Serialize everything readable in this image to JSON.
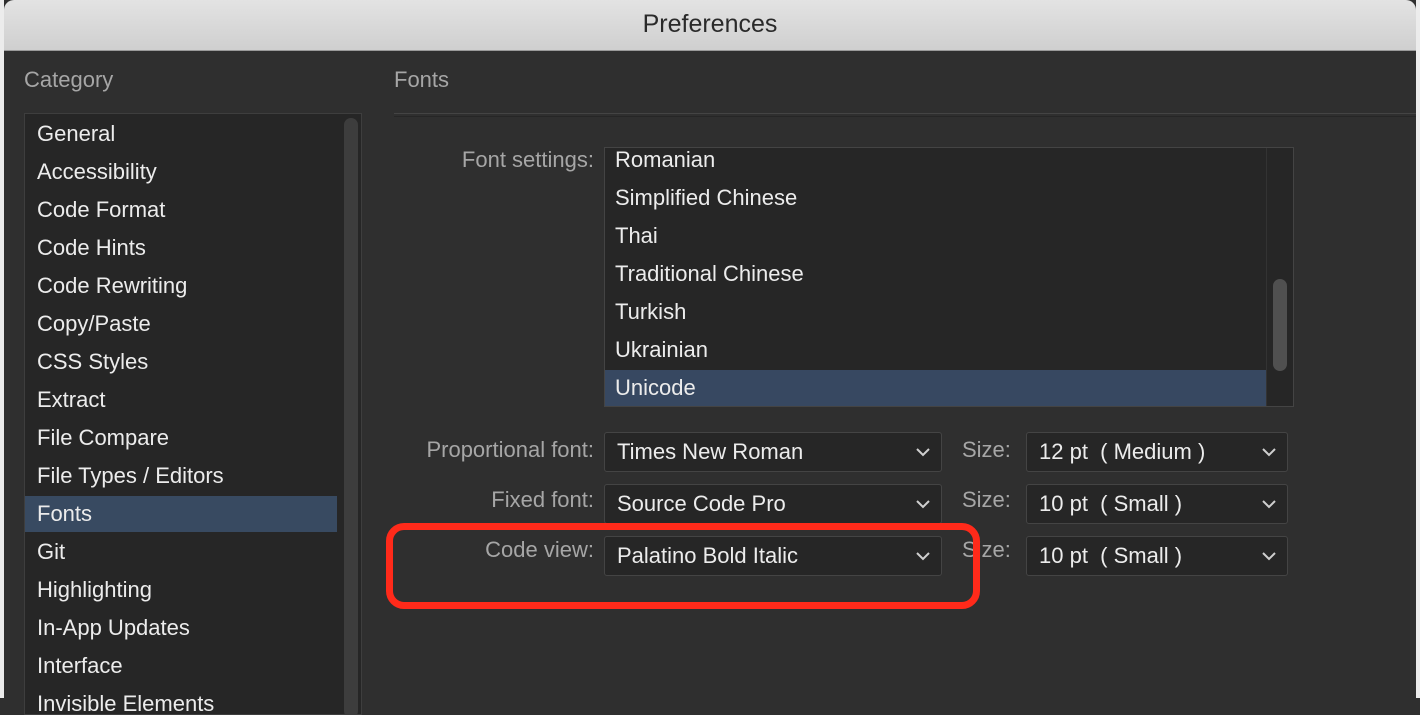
{
  "window": {
    "title": "Preferences"
  },
  "category": {
    "header": "Category",
    "items": [
      "General",
      "Accessibility",
      "Code Format",
      "Code Hints",
      "Code Rewriting",
      "Copy/Paste",
      "CSS Styles",
      "Extract",
      "File Compare",
      "File Types / Editors",
      "Fonts",
      "Git",
      "Highlighting",
      "In-App Updates",
      "Interface",
      "Invisible Elements"
    ],
    "selected": "Fonts"
  },
  "fonts": {
    "header": "Fonts",
    "font_settings_label": "Font settings:",
    "font_settings_items": [
      "Romanian",
      "Simplified Chinese",
      "Thai",
      "Traditional Chinese",
      "Turkish",
      "Ukrainian",
      "Unicode"
    ],
    "font_settings_selected": "Unicode",
    "proportional_label": "Proportional font:",
    "proportional_value": "Times New Roman",
    "proportional_size_label": "Size:",
    "proportional_size_value": "12 pt  ( Medium )",
    "fixed_label": "Fixed font:",
    "fixed_value": "Source Code Pro",
    "fixed_size_label": "Size:",
    "fixed_size_value": "10 pt  ( Small )",
    "codeview_label": "Code view:",
    "codeview_value": "Palatino Bold Italic",
    "codeview_size_label": "Size:",
    "codeview_size_value": "10 pt  ( Small )"
  },
  "icons": {
    "chevron": "chevron-down-icon"
  },
  "colors": {
    "selection": "#384a61",
    "highlight_ring": "#ff2a1a"
  }
}
